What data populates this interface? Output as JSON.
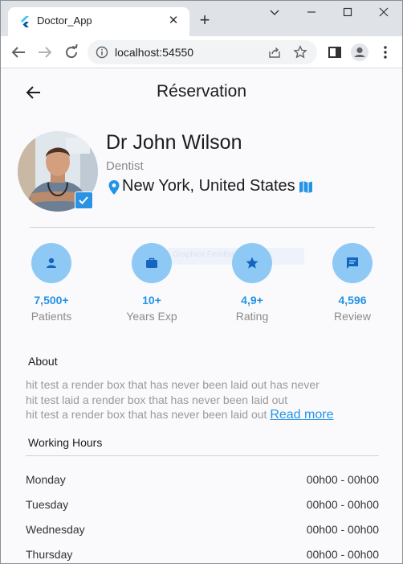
{
  "browser": {
    "tab_title": "Doctor_App",
    "url": "localhost:54550"
  },
  "page": {
    "title": "Réservation"
  },
  "doctor": {
    "name": "Dr John Wilson",
    "specialty": "Dentist",
    "location": "New York, United States"
  },
  "ghost_label": "Graphics Feedback",
  "stats": [
    {
      "icon": "person-icon",
      "value": "7,500+",
      "label": "Patients"
    },
    {
      "icon": "briefcase-icon",
      "value": "10+",
      "label": "Years Exp"
    },
    {
      "icon": "star-icon",
      "value": "4,9+",
      "label": "Rating"
    },
    {
      "icon": "message-icon",
      "value": "4,596",
      "label": "Review"
    }
  ],
  "about": {
    "title": "About",
    "lines": [
      "hit test a render box that has never been laid out has never",
      "hit test laid a render box that has never been laid out",
      "hit test a render box that has never been laid out"
    ],
    "read_more": "Read more"
  },
  "working_hours": {
    "title": "Working Hours",
    "rows": [
      {
        "day": "Monday",
        "time": "00h00 - 00h00"
      },
      {
        "day": "Tuesday",
        "time": "00h00 - 00h00"
      },
      {
        "day": "Wednesday",
        "time": "00h00 - 00h00"
      },
      {
        "day": "Thursday",
        "time": "00h00 - 00h00"
      }
    ]
  },
  "colors": {
    "accent": "#2493e6",
    "stat_circle": "#8ec9f5",
    "icon_dark": "#1565c0"
  }
}
